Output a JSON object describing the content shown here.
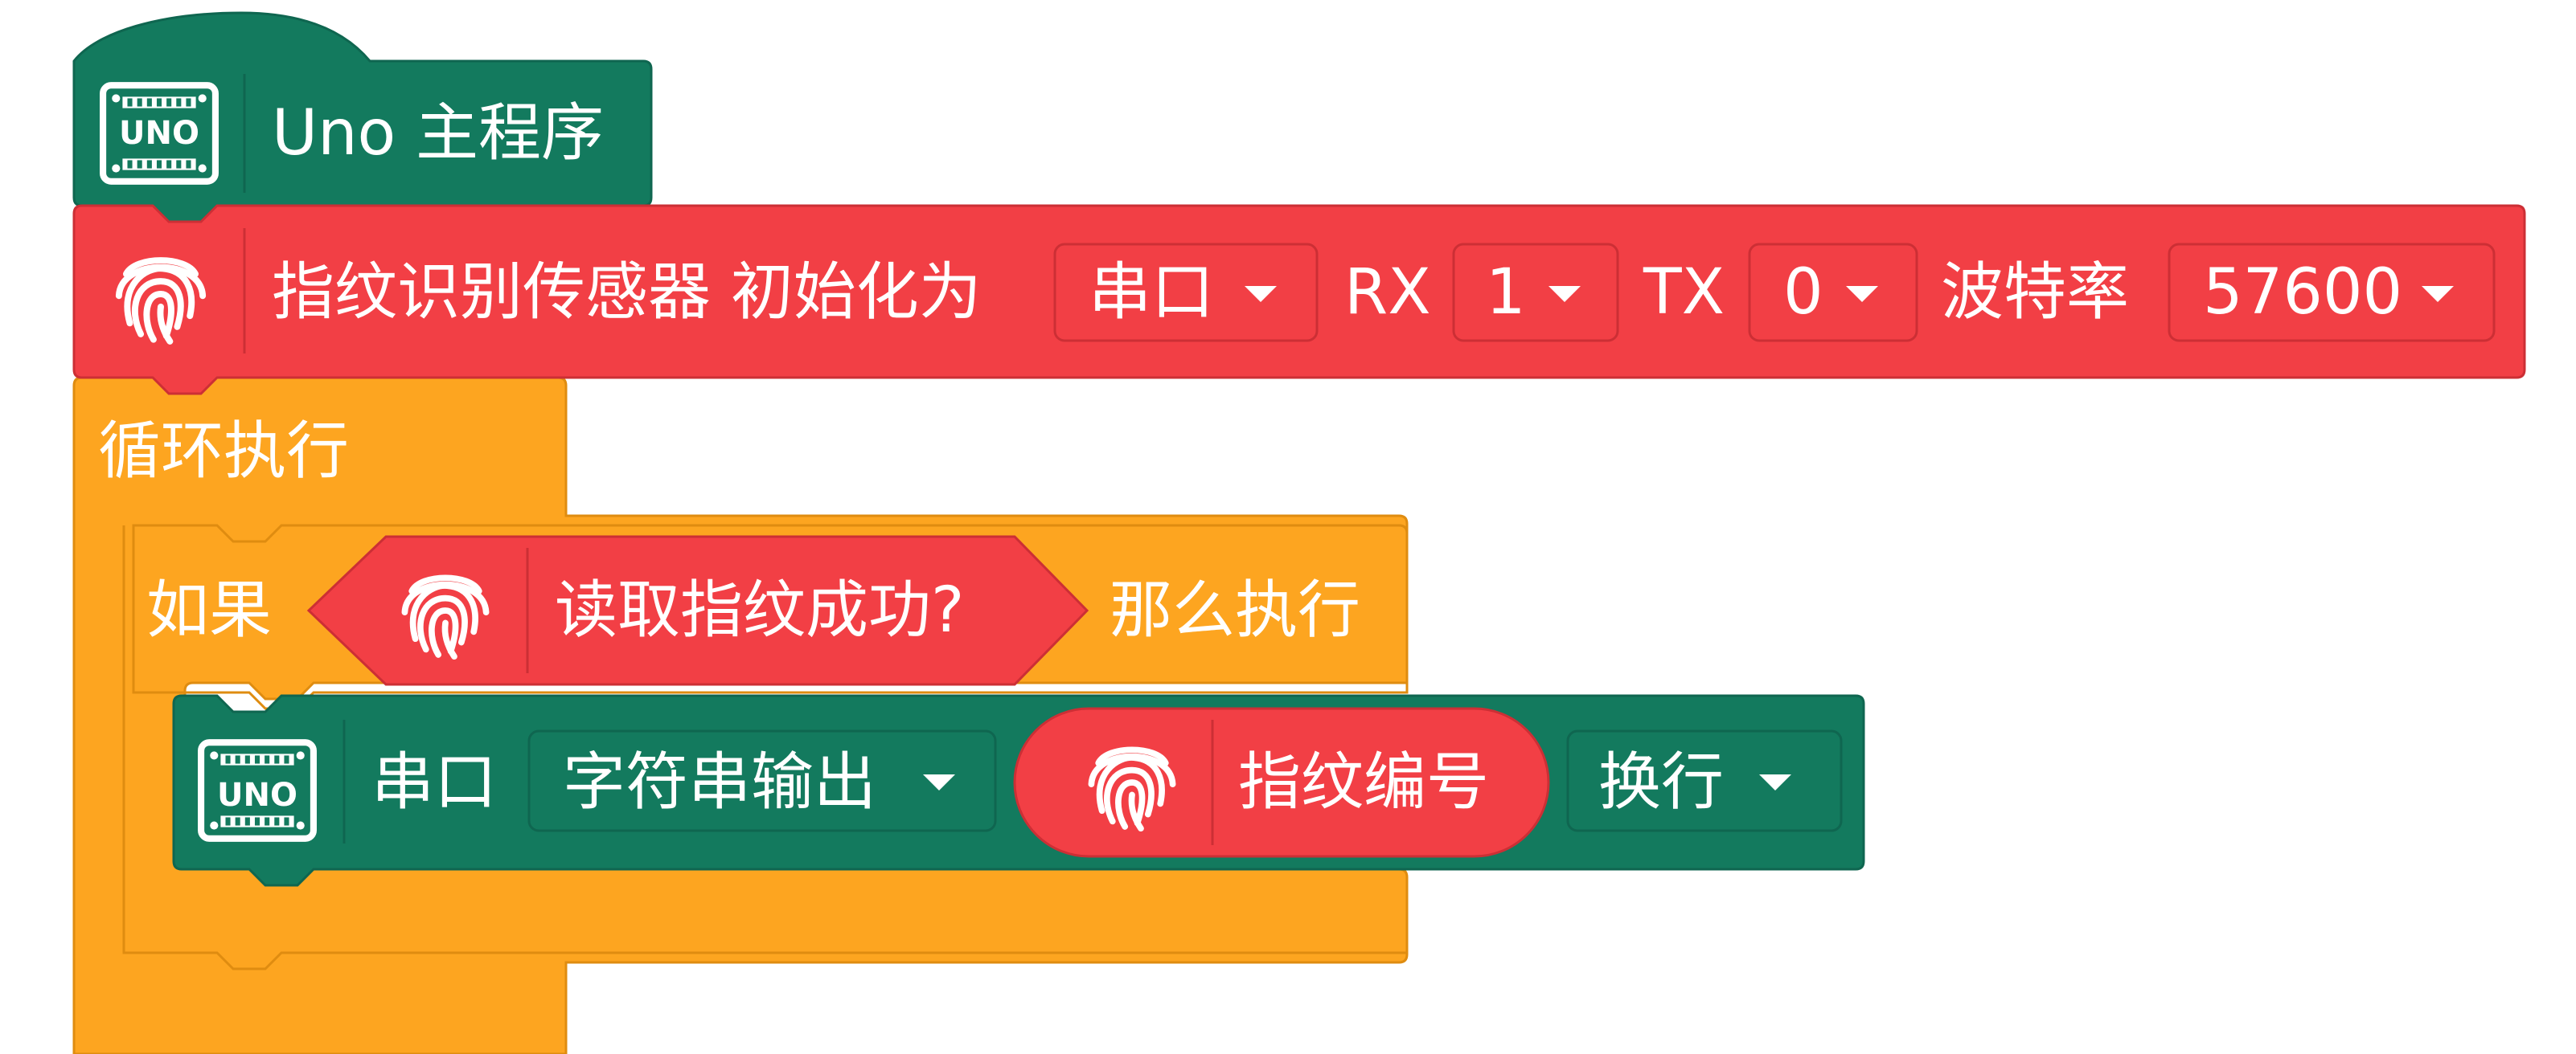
{
  "colors": {
    "uno_block": "#137a5e",
    "uno_block_border": "#0f6650",
    "sensor_block": "#f23f45",
    "sensor_block_border": "#cc2f35",
    "control_block": "#fda520",
    "control_block_border": "#df8c10",
    "text": "#ffffff"
  },
  "main_block": {
    "icon": "uno-board-icon",
    "icon_text": "UNO",
    "label": "Uno 主程序"
  },
  "init_block": {
    "icon": "fingerprint-icon",
    "label": "指纹识别传感器 初始化为",
    "port_dropdown": "串口",
    "rx_label": "RX",
    "rx_dropdown": "1",
    "tx_label": "TX",
    "tx_dropdown": "0",
    "baud_label": "波特率",
    "baud_dropdown": "57600"
  },
  "loop_block": {
    "label": "循环执行"
  },
  "if_block": {
    "if_label": "如果",
    "condition": {
      "icon": "fingerprint-icon",
      "label": "读取指纹成功?"
    },
    "then_label": "那么执行"
  },
  "serial_block": {
    "icon": "uno-board-icon",
    "icon_text": "UNO",
    "label": "串口",
    "mode_dropdown": "字符串输出",
    "value": {
      "icon": "fingerprint-icon",
      "label": "指纹编号"
    },
    "newline_dropdown": "换行"
  }
}
